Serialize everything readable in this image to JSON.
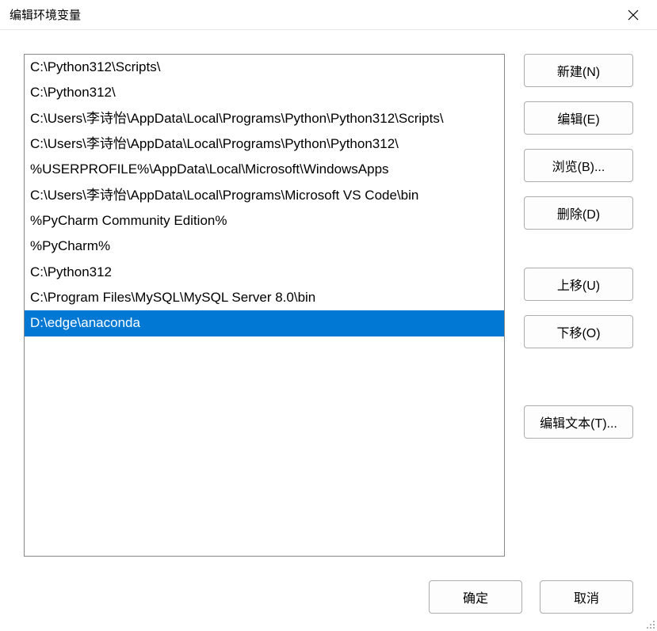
{
  "title": "编辑环境变量",
  "list": {
    "items": [
      "C:\\Python312\\Scripts\\",
      "C:\\Python312\\",
      "C:\\Users\\李诗怡\\AppData\\Local\\Programs\\Python\\Python312\\Scripts\\",
      "C:\\Users\\李诗怡\\AppData\\Local\\Programs\\Python\\Python312\\",
      "%USERPROFILE%\\AppData\\Local\\Microsoft\\WindowsApps",
      "C:\\Users\\李诗怡\\AppData\\Local\\Programs\\Microsoft VS Code\\bin",
      "%PyCharm Community Edition%",
      "%PyCharm%",
      "C:\\Python312",
      "C:\\Program Files\\MySQL\\MySQL Server 8.0\\bin",
      "D:\\edge\\anaconda"
    ],
    "selectedIndex": 10
  },
  "buttons": {
    "new": "新建(N)",
    "edit": "编辑(E)",
    "browse": "浏览(B)...",
    "delete": "删除(D)",
    "moveup": "上移(U)",
    "movedown": "下移(O)",
    "edittext": "编辑文本(T)...",
    "ok": "确定",
    "cancel": "取消"
  }
}
